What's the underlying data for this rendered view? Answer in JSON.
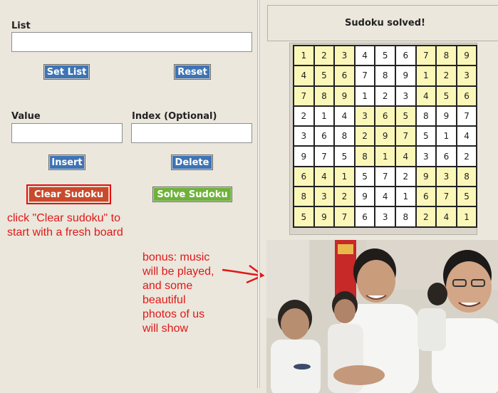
{
  "list": {
    "label": "List",
    "value": "",
    "set_button": "Set List",
    "reset_button": "Reset"
  },
  "value_field": {
    "label": "Value",
    "value": ""
  },
  "index_field": {
    "label": "Index (Optional)",
    "value": ""
  },
  "insert_button": "Insert",
  "delete_button": "Delete",
  "clear_button": "Clear Sudoku",
  "solve_button": "Solve Sudoku",
  "status": "Sudoku solved!",
  "annotation_clear": "click \"Clear sudoku\" to\nstart with a fresh board",
  "annotation_bonus": "bonus: music\nwill be played,\nand some\nbeautiful\nphotos of us\nwill show",
  "board": [
    [
      "1",
      "2",
      "3",
      "4",
      "5",
      "6",
      "7",
      "8",
      "9"
    ],
    [
      "4",
      "5",
      "6",
      "7",
      "8",
      "9",
      "1",
      "2",
      "3"
    ],
    [
      "7",
      "8",
      "9",
      "1",
      "2",
      "3",
      "4",
      "5",
      "6"
    ],
    [
      "2",
      "1",
      "4",
      "3",
      "6",
      "5",
      "8",
      "9",
      "7"
    ],
    [
      "3",
      "6",
      "8",
      "2",
      "9",
      "7",
      "5",
      "1",
      "4"
    ],
    [
      "9",
      "7",
      "5",
      "8",
      "1",
      "4",
      "3",
      "6",
      "2"
    ],
    [
      "6",
      "4",
      "1",
      "5",
      "7",
      "2",
      "9",
      "3",
      "8"
    ],
    [
      "8",
      "3",
      "2",
      "9",
      "4",
      "1",
      "6",
      "7",
      "5"
    ],
    [
      "5",
      "9",
      "7",
      "6",
      "3",
      "8",
      "2",
      "4",
      "1"
    ]
  ],
  "colors": {
    "panel_bg": "#ebe7dc",
    "button_blue": "#3d74b5",
    "button_clear": "#c84a2c",
    "button_solve": "#6fb13a",
    "annotation_red": "#e01818",
    "box_highlight": "#fbf7b8"
  }
}
